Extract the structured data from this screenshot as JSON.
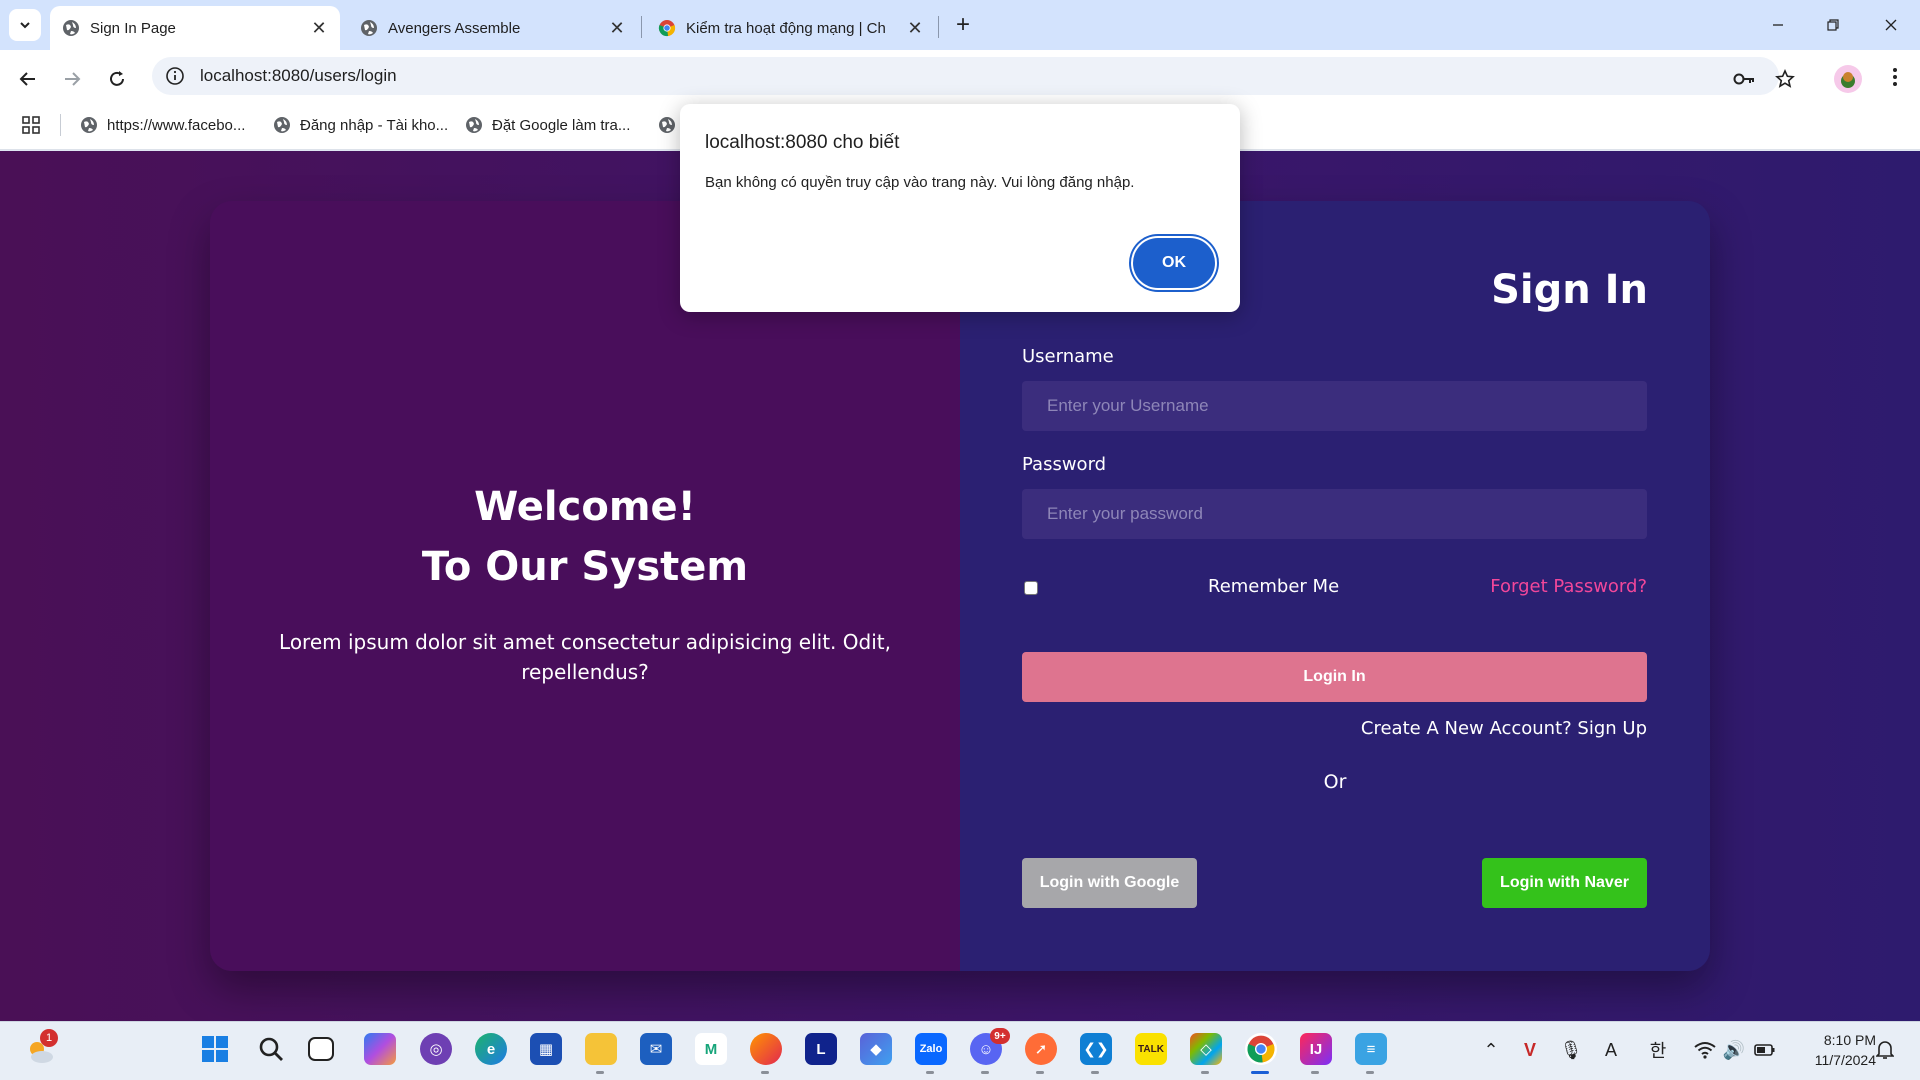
{
  "browser": {
    "tabs": [
      {
        "title": "Sign In Page",
        "icon": "globe-icon",
        "active": true
      },
      {
        "title": "Avengers Assemble",
        "icon": "globe-icon",
        "active": false
      },
      {
        "title": "Kiểm tra hoạt động mạng | Ch",
        "icon": "chrome-icon",
        "active": false
      }
    ],
    "url": "localhost:8080/users/login",
    "bookmarks": [
      {
        "label": "https://www.facebo...",
        "icon": "globe-icon"
      },
      {
        "label": "Đăng nhập - Tài kho...",
        "icon": "globe-icon"
      },
      {
        "label": "Đặt Google làm tra...",
        "icon": "globe-icon"
      }
    ]
  },
  "dialog": {
    "title": "localhost:8080 cho biết",
    "message": "Bạn không có quyền truy cập vào trang này. Vui lòng đăng nhập.",
    "ok_label": "OK"
  },
  "welcome": {
    "line1": "Welcome!",
    "line2": "To Our System",
    "text": "Lorem ipsum dolor sit amet consectetur adipisicing elit. Odit, repellendus?"
  },
  "signin": {
    "title": "Sign In",
    "username_label": "Username",
    "username_placeholder": "Enter your Username",
    "password_label": "Password",
    "password_placeholder": "Enter your password",
    "remember_label": "Remember Me",
    "remember_checked": false,
    "forget_label": "Forget Password?",
    "login_label": "Login In",
    "create_label": "Create A New Account? Sign Up",
    "or_label": "Or",
    "google_label": "Login with Google",
    "naver_label": "Login with Naver"
  },
  "colors": {
    "left_panel": "#490e5b",
    "right_panel": "#2b2072",
    "login_button": "#de748f",
    "forget_link": "#f2479a",
    "google_button": "#a7a7aa",
    "naver_button": "#34c21b",
    "dialog_ok": "#1c5fcc"
  },
  "taskbar": {
    "weather_badge": "1",
    "discord_badge": "9+",
    "time": "8:10 PM",
    "date": "11/7/2024",
    "apps": [
      "windows-start-icon",
      "search-icon",
      "task-view-icon",
      "copilot-icon",
      "github-icon",
      "edge-icon",
      "store-icon",
      "file-explorer-icon",
      "mail-icon",
      "m-app-icon",
      "firefox-icon",
      "l-app-icon",
      "teams-icon",
      "zalo-icon",
      "discord-icon",
      "postman-icon",
      "vscode-icon",
      "kakaotalk-icon",
      "git-icon",
      "chrome-icon",
      "intellij-icon",
      "notepad-icon"
    ]
  }
}
